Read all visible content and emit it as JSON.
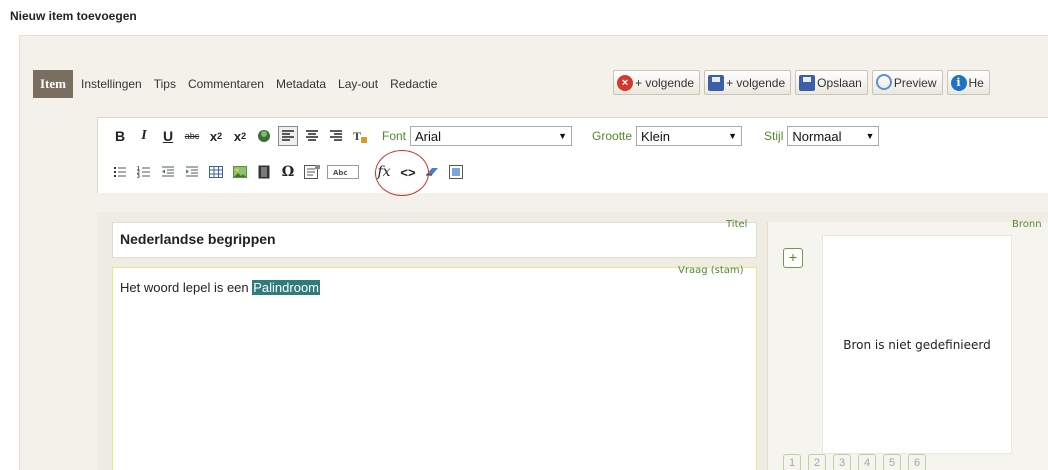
{
  "page": {
    "title": "Nieuw item toevoegen"
  },
  "tabs": [
    {
      "label": "Item",
      "active": true
    },
    {
      "label": "Instellingen"
    },
    {
      "label": "Tips"
    },
    {
      "label": "Commentaren"
    },
    {
      "label": "Metadata"
    },
    {
      "label": "Lay-out"
    },
    {
      "label": "Redactie"
    }
  ],
  "actions": [
    {
      "label": "+ volgende",
      "icon": "cancel-icon"
    },
    {
      "label": "+ volgende",
      "icon": "save-icon"
    },
    {
      "label": "Opslaan",
      "icon": "save-icon"
    },
    {
      "label": "Preview",
      "icon": "magnifier-icon"
    },
    {
      "label": "He",
      "icon": "help-icon"
    }
  ],
  "editor": {
    "font_label": "Font",
    "font_value": "Arial",
    "size_label": "Grootte",
    "size_value": "Klein",
    "style_label": "Stijl",
    "style_value": "Normaal"
  },
  "fields": {
    "title_tag": "Titel",
    "title_value": "Nederlandse begrippen",
    "question_tag": "Vraag (stam)",
    "question_text_before": "Het woord lepel is een ",
    "question_text_selected": "Palindroom",
    "sources_tag": "Bronn"
  },
  "source": {
    "plus_label": "+",
    "empty_text": "Bron is niet gedefinieerd",
    "pages": [
      "1",
      "2",
      "3",
      "4",
      "5",
      "6"
    ]
  },
  "colors": {
    "accent_green": "#4f8a2e",
    "active_tab": "#7a6e60",
    "selection": "#2f7d7a",
    "highlight_ring": "#d1312b"
  }
}
